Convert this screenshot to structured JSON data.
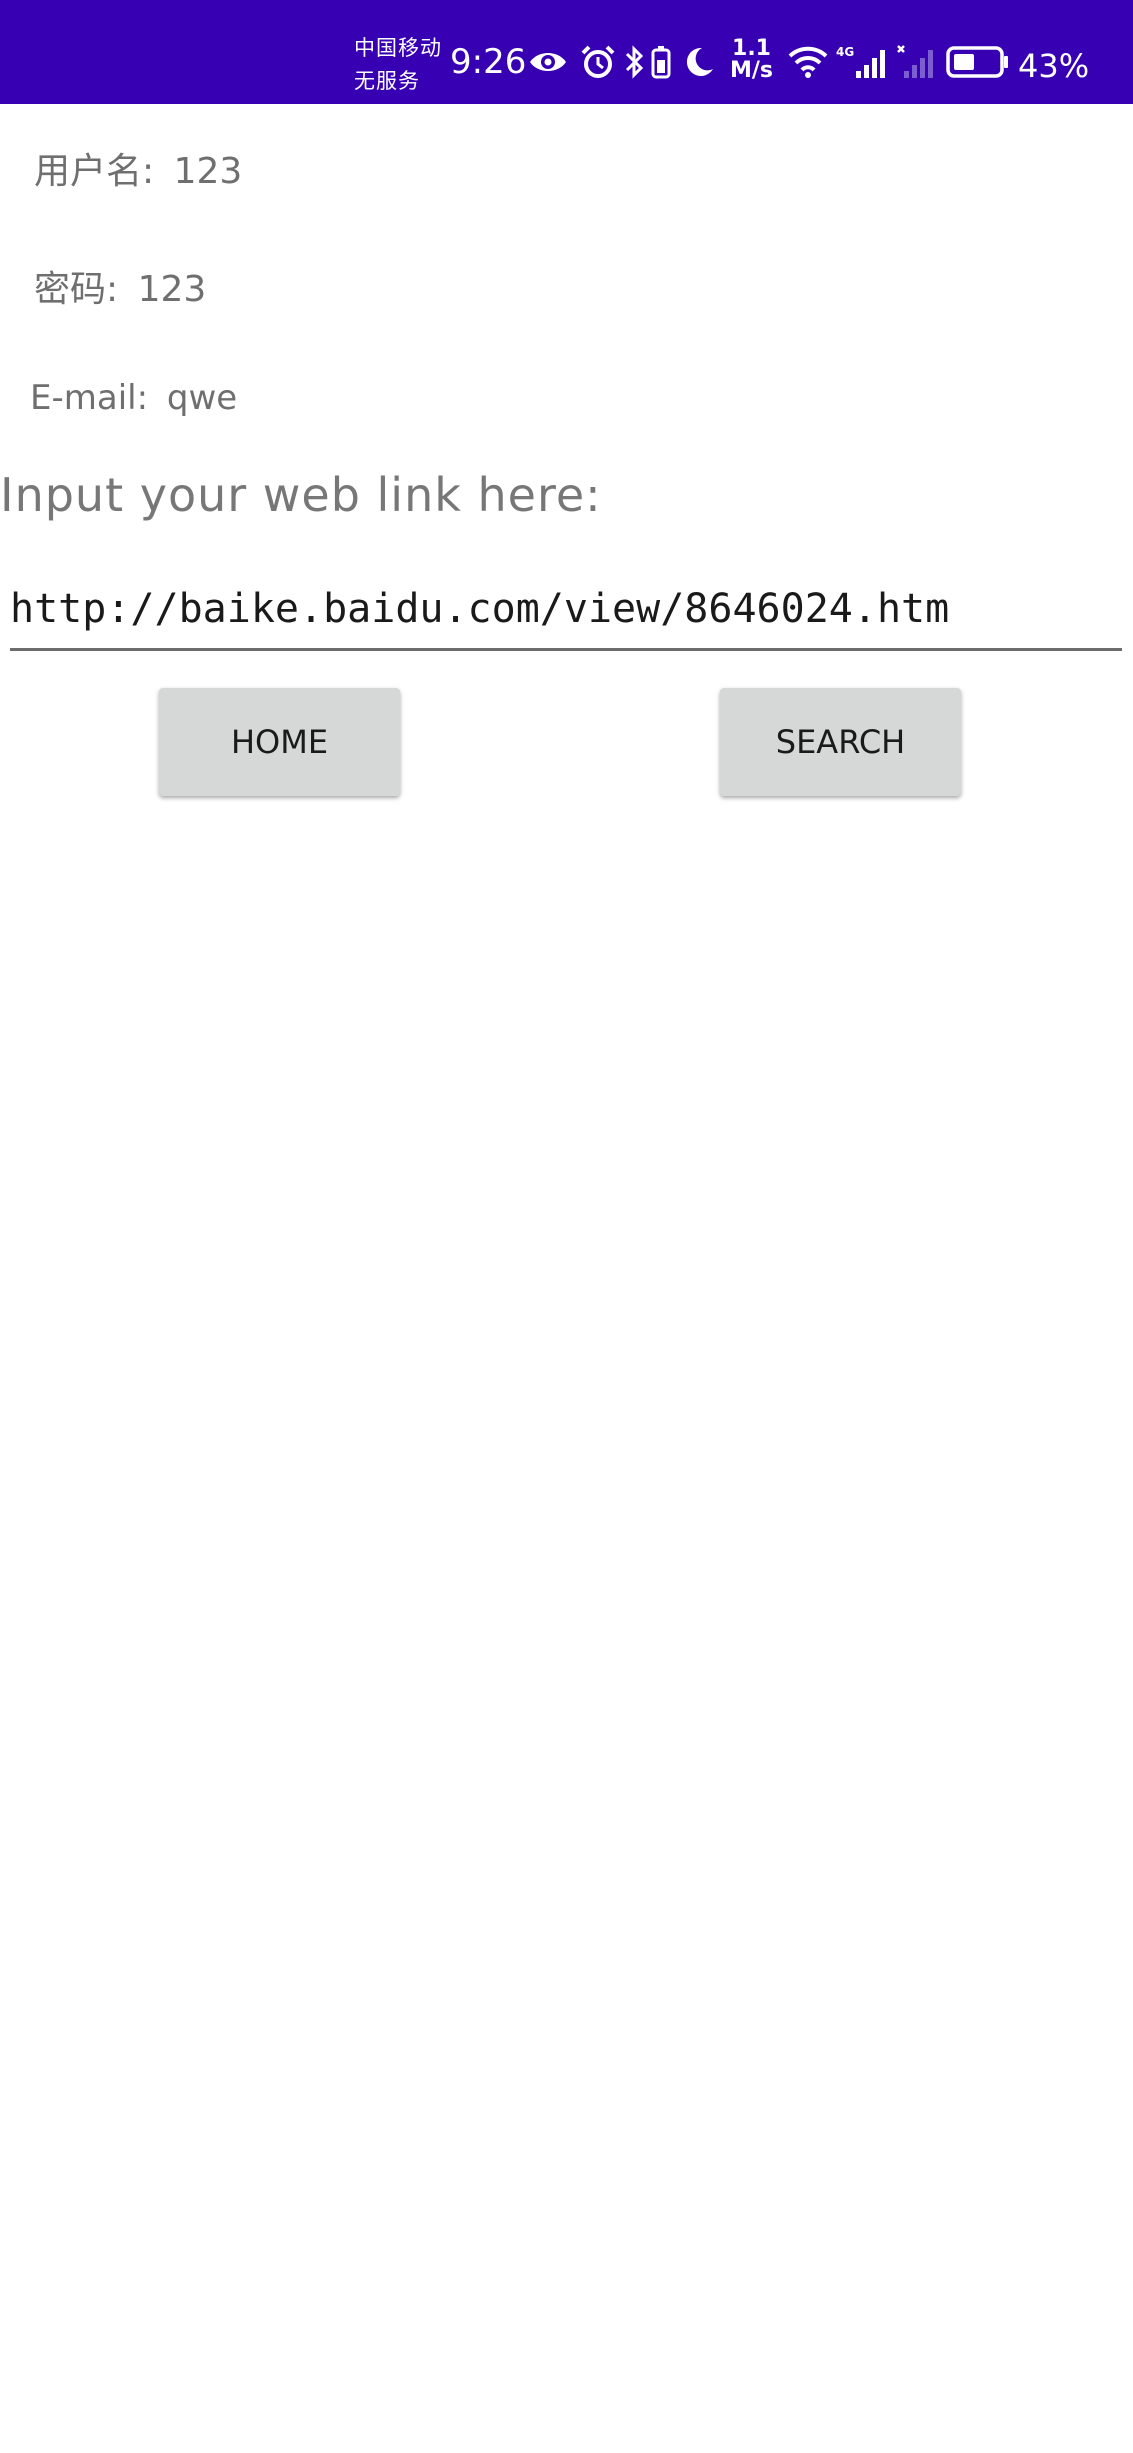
{
  "status_bar": {
    "carrier_line1": "中国移动",
    "carrier_line2": "无服务",
    "time": "9:26",
    "net_speed_value": "1.1",
    "net_speed_unit": "M/s",
    "battery_percent": "43%",
    "background_color": "#3700b3",
    "icons": [
      "eye-icon",
      "alarm-icon",
      "bluetooth-icon",
      "battery-saver-icon",
      "moon-icon",
      "wifi-icon",
      "signal-4g-icon",
      "signal-no-service-icon",
      "battery-icon"
    ]
  },
  "form": {
    "username_label": "用户名:",
    "username_value": "123",
    "password_label": "密码:",
    "password_value": "123",
    "email_label": "E-mail:",
    "email_value": "qwe",
    "prompt": "Input your web link here:",
    "url_value": "http://baike.baidu.com/view/8646024.htm"
  },
  "buttons": {
    "home_label": "HOME",
    "search_label": "SEARCH"
  }
}
